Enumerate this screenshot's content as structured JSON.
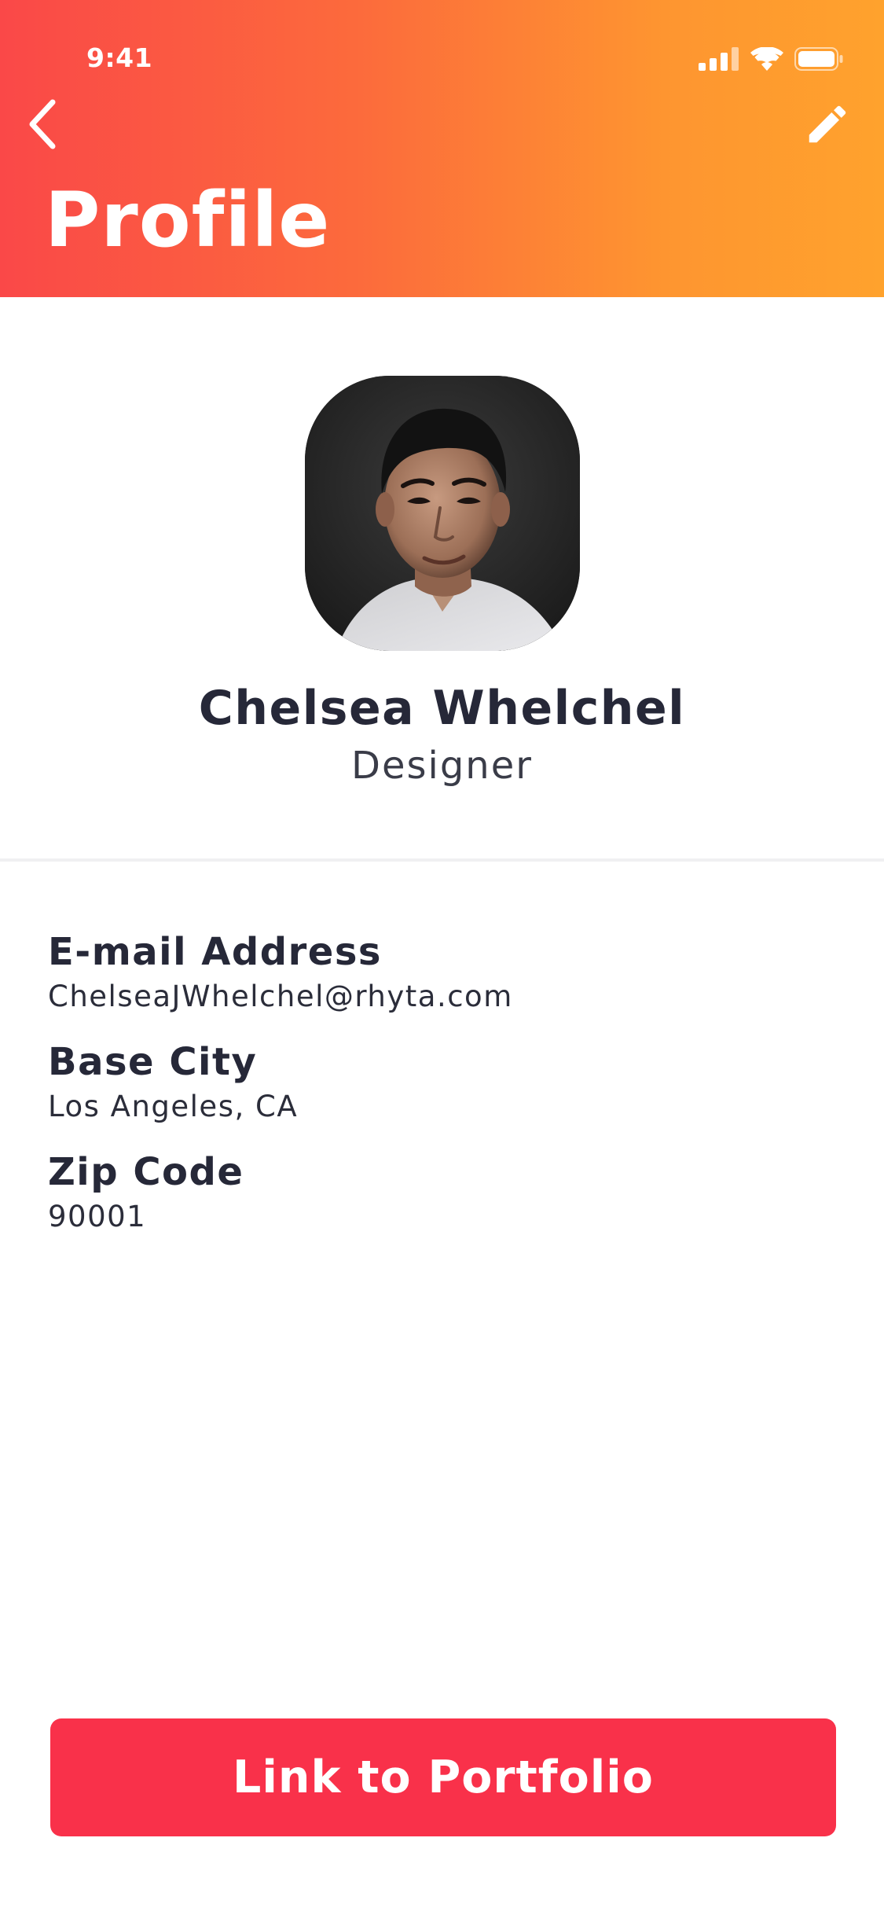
{
  "status_bar": {
    "time": "9:41"
  },
  "header": {
    "title": "Profile",
    "back_icon": "chevron-left-icon",
    "edit_icon": "pencil-icon",
    "gradient_start": "#fa4848",
    "gradient_end": "#ffa22d"
  },
  "profile": {
    "name": "Chelsea Whelchel",
    "role": "Designer"
  },
  "details": [
    {
      "label": "E-mail Address",
      "value": "ChelseaJWhelchel@rhyta.com"
    },
    {
      "label": "Base City",
      "value": "Los Angeles, CA"
    },
    {
      "label": "Zip Code",
      "value": "90001"
    }
  ],
  "actions": {
    "portfolio_label": "Link to Portfolio",
    "portfolio_color": "#f9314a"
  }
}
